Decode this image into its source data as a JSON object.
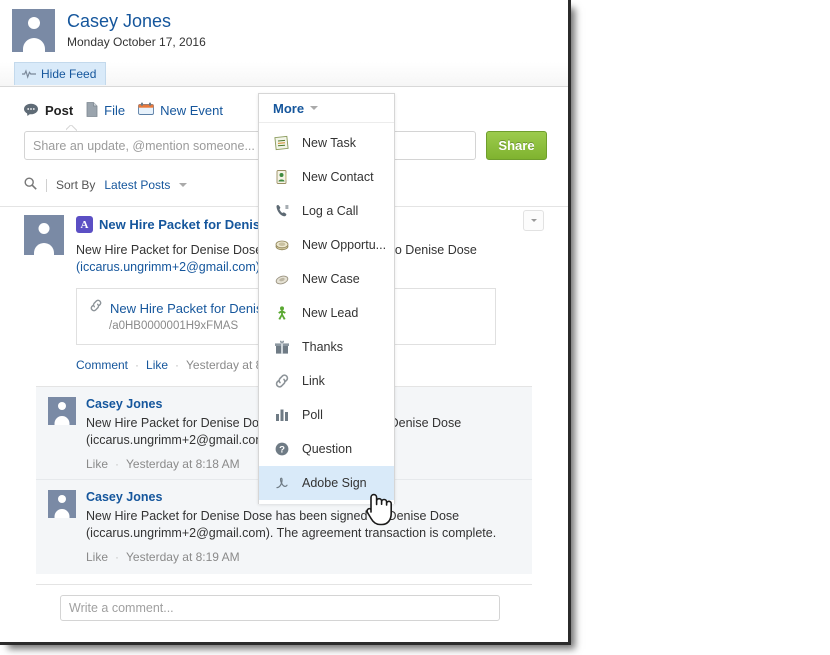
{
  "header": {
    "user_name": "Casey Jones",
    "date": "Monday October 17, 2016",
    "avatar_icon": "user-avatar-icon"
  },
  "feedbar": {
    "hide_feed_label": "Hide Feed",
    "hide_feed_icon": "pulse-icon"
  },
  "publisher": {
    "tabs": [
      {
        "label": "Post",
        "icon": "comment-bubble-icon",
        "active": true
      },
      {
        "label": "File",
        "icon": "file-icon",
        "active": false
      },
      {
        "label": "New Event",
        "icon": "calendar-icon",
        "active": false
      }
    ],
    "share_placeholder": "Share an update, @mention someone...",
    "share_value": "",
    "share_button": "Share",
    "share_button_color": "#8ac43f"
  },
  "more_menu": {
    "label": "More",
    "caret_icon": "chevron-down-icon",
    "items": [
      {
        "label": "New Task",
        "icon": "task-list-icon",
        "selected": false
      },
      {
        "label": "New Contact",
        "icon": "contact-card-icon",
        "selected": false
      },
      {
        "label": "Log a Call",
        "icon": "phone-icon",
        "selected": false
      },
      {
        "label": "New Opportu...",
        "icon": "opportunity-coin-icon",
        "selected": false
      },
      {
        "label": "New Case",
        "icon": "case-briefcase-icon",
        "selected": false
      },
      {
        "label": "New Lead",
        "icon": "lead-person-icon",
        "selected": false
      },
      {
        "label": "Thanks",
        "icon": "gift-icon",
        "selected": false
      },
      {
        "label": "Link",
        "icon": "link-chain-icon",
        "selected": false
      },
      {
        "label": "Poll",
        "icon": "bar-chart-icon",
        "selected": false
      },
      {
        "label": "Question",
        "icon": "question-mark-icon",
        "selected": false
      },
      {
        "label": "Adobe Sign",
        "icon": "adobe-sign-icon",
        "selected": true
      }
    ]
  },
  "sort": {
    "search_icon": "search-icon",
    "label": "Sort By",
    "value": "Latest Posts",
    "caret_icon": "chevron-down-icon"
  },
  "post": {
    "author": "Casey Jones",
    "file_icon": "pdf-icon",
    "file_icon_letter": "A",
    "title": "New Hire Packet for Denise Dose",
    "body_line1": "New Hire Packet for Denise Dose was sent for signature to Denise Dose",
    "body_email": "(iccarus.ungrimm+2@gmail.com).",
    "attachment": {
      "link_icon": "link-chain-icon",
      "name": "New Hire Packet for Denise Dose",
      "path": "/a0HB0000001H9xFMAS"
    },
    "actions": {
      "comment": "Comment",
      "like": "Like",
      "timestamp": "Yesterday at 8:18 AM"
    },
    "menu_icon": "chevron-down-icon"
  },
  "comments": [
    {
      "author": "Casey Jones",
      "text": "New Hire Packet for Denise Dose has been viewed by Denise Dose (iccarus.ungrimm+2@gmail.com).",
      "like": "Like",
      "timestamp": "Yesterday at 8:18 AM",
      "avatar_icon": "user-avatar-icon"
    },
    {
      "author": "Casey Jones",
      "text": "New Hire Packet for Denise Dose has been signed by Denise Dose (iccarus.ungrimm+2@gmail.com). The agreement transaction is complete.",
      "like": "Like",
      "timestamp": "Yesterday at 8:19 AM",
      "avatar_icon": "user-avatar-icon"
    }
  ],
  "comment_box": {
    "placeholder": "Write a comment...",
    "value": ""
  },
  "cursor": {
    "icon": "hand-pointer-cursor"
  }
}
